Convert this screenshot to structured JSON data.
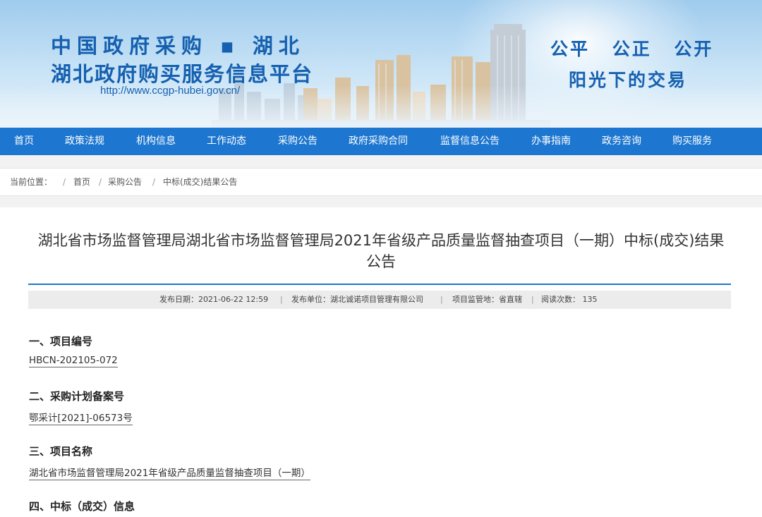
{
  "banner": {
    "title_line1": "中国政府采购 ▪ 湖北",
    "title_line2": "湖北政府购买服务信息平台",
    "url": "http://www.ccgp-hubei.gov.cn/",
    "slogan_line1": "公平  公正  公开",
    "slogan_line2": "阳光下的交易"
  },
  "nav": {
    "items": [
      "首页",
      "政策法规",
      "机构信息",
      "工作动态",
      "采购公告",
      "政府采购合同",
      "监督信息公告",
      "办事指南",
      "政务咨询",
      "购买服务"
    ]
  },
  "breadcrumb": {
    "label": "当前位置：",
    "items": [
      "首页",
      "采购公告",
      "中标(成交)结果公告"
    ]
  },
  "article": {
    "title_line1": "湖北省市场监督管理局湖北省市场监督管理局2021年省级产品质量监督抽查项目（一期）中标(成交)结果",
    "title_line2": "公告",
    "meta": {
      "publish_date": "发布日期：2021-06-22 12:59",
      "publisher": "发布单位：湖北诚诺项目管理有限公司",
      "region": "项目监管地：省直辖",
      "views": "阅读次数： 135"
    },
    "sections": [
      {
        "heading": "一、项目编号",
        "value": "HBCN-202105-072"
      },
      {
        "heading": "二、采购计划备案号",
        "value": "鄂采计[2021]-06573号"
      },
      {
        "heading": "三、项目名称",
        "value": "湖北省市场监督管理局2021年省级产品质量监督抽查项目（一期）"
      },
      {
        "heading": "四、中标（成交）信息",
        "value": ""
      }
    ]
  }
}
